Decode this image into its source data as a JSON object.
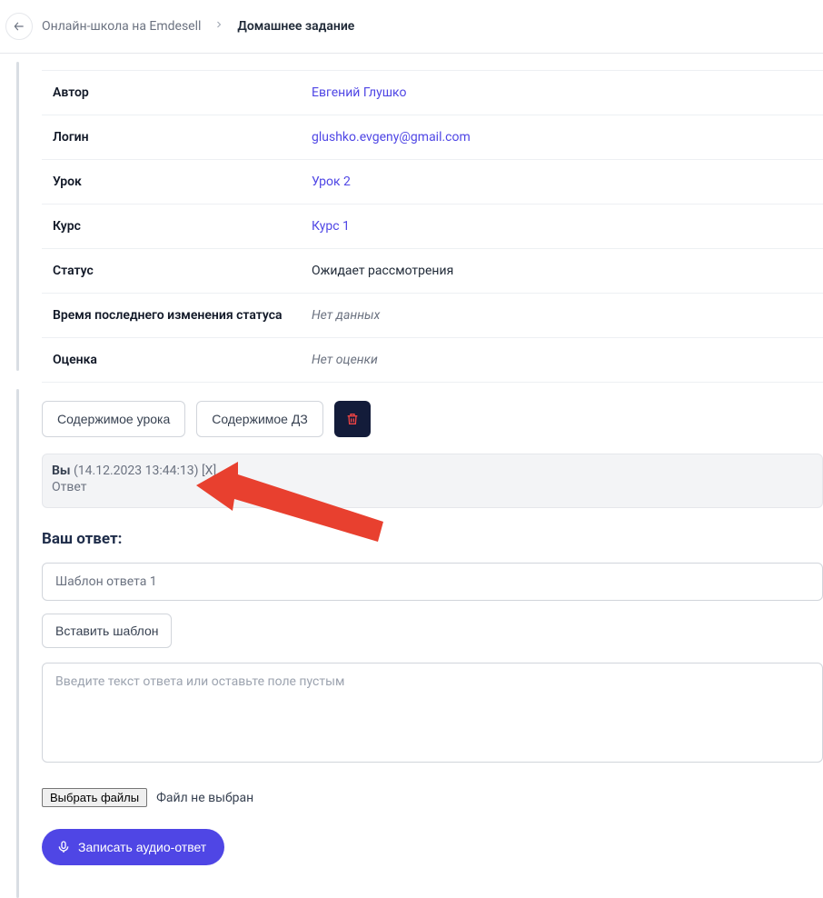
{
  "breadcrumb": {
    "parent": "Онлайн-школа на Emdesell",
    "current": "Домашнее задание"
  },
  "info": {
    "author_label": "Автор",
    "author_value": "Евгений Глушко",
    "login_label": "Логин",
    "login_value": "glushko.evgeny@gmail.com",
    "lesson_label": "Урок",
    "lesson_value": "Урок 2",
    "course_label": "Курс",
    "course_value": "Курс 1",
    "status_label": "Статус",
    "status_value": "Ожидает рассмотрения",
    "status_time_label": "Время последнего изменения статуса",
    "status_time_value": "Нет данных",
    "grade_label": "Оценка",
    "grade_value": "Нет оценки"
  },
  "actions": {
    "lesson_content": "Содержимое урока",
    "hw_content": "Содержимое ДЗ"
  },
  "message": {
    "who": "Вы",
    "when": "(14.12.2023 13:44:13)",
    "del": "[X]",
    "body": "Ответ"
  },
  "answer": {
    "title": "Ваш ответ:",
    "template_placeholder": "Шаблон ответа 1",
    "insert_template": "Вставить шаблон",
    "textarea_placeholder": "Введите текст ответа или оставьте поле пустым",
    "choose_files": "Выбрать файлы",
    "no_file": "Файл не выбран",
    "record_audio": "Записать аудио-ответ"
  }
}
